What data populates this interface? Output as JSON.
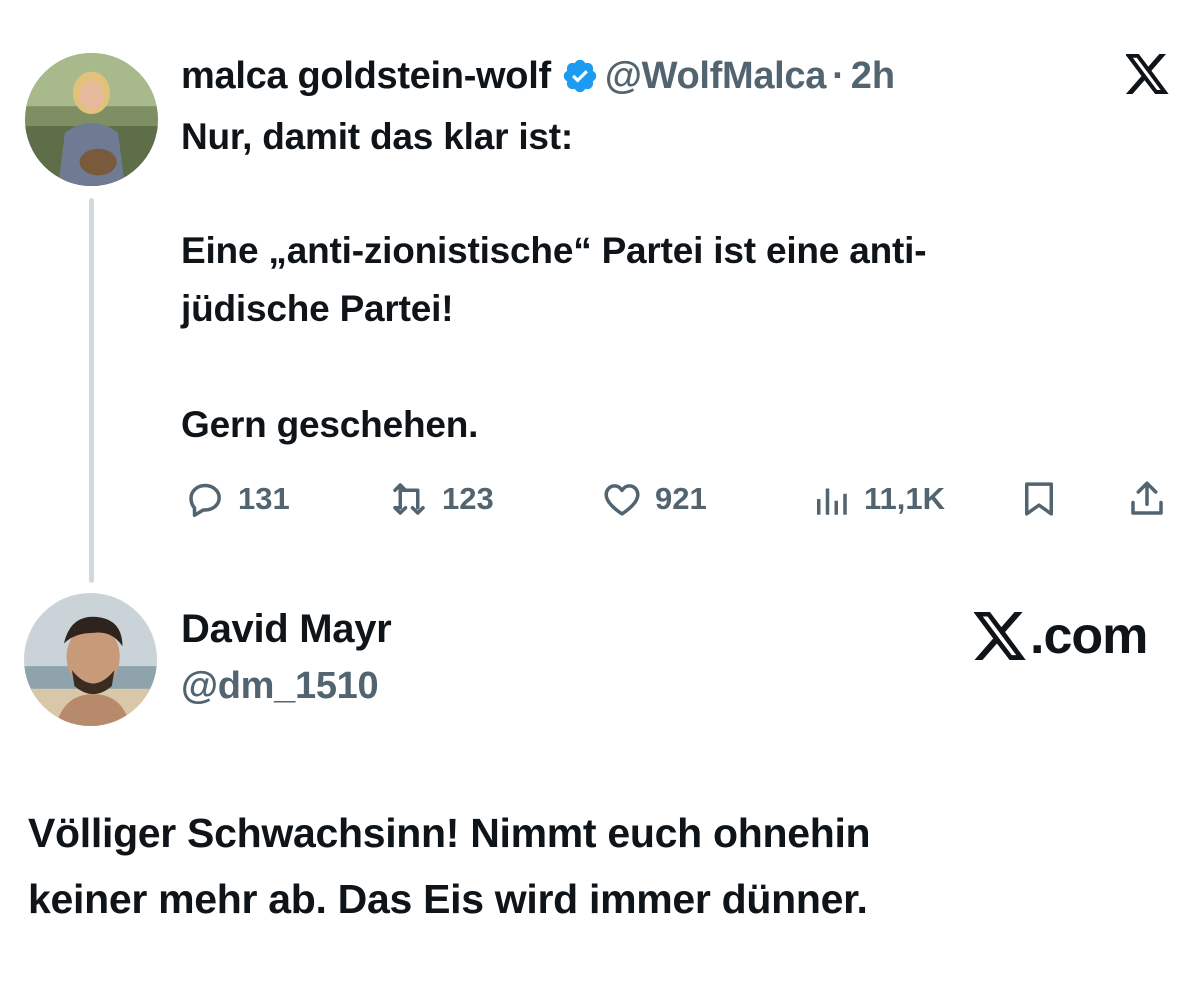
{
  "original_tweet": {
    "author_name": "malca goldstein-wolf",
    "verified": true,
    "handle": "@WolfMalca",
    "separator": "·",
    "time": "2h",
    "lines": [
      "Nur, damit das klar ist:",
      "Eine „anti-zionistische“ Partei ist eine anti-",
      "jüdische Partei!",
      "Gern geschehen."
    ],
    "actions": {
      "replies": "131",
      "reposts": "123",
      "likes": "921",
      "views": "11,1K"
    },
    "icons": [
      "x-logo-icon",
      "verified-badge-icon",
      "reply-icon",
      "repost-icon",
      "like-icon",
      "views-icon",
      "bookmark-icon",
      "share-icon"
    ]
  },
  "reply_user": {
    "name": "David Mayr",
    "handle": "@dm_1510",
    "brand_text": ".com"
  },
  "reply_text": {
    "lines": [
      "Völliger Schwachsinn! Nimmt euch ohnehin",
      "keiner mehr ab. Das Eis wird immer dünner."
    ]
  },
  "colors": {
    "text": "#0f1419",
    "secondary": "#536471",
    "verified": "#1d9bf0",
    "thread_line": "#cfd9de"
  }
}
